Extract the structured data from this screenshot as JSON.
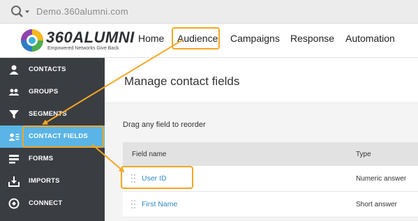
{
  "browser": {
    "url": "Demo.360alumni.com",
    "search_icon": "search-icon"
  },
  "header": {
    "logo_text": "360ALUMNI",
    "logo_tagline": "Empowered Networks Give Back",
    "nav": [
      "Home",
      "Audience",
      "Campaigns",
      "Response",
      "Automation"
    ]
  },
  "sidebar": {
    "items": [
      {
        "label": "CONTACTS",
        "icon": "person-icon"
      },
      {
        "label": "GROUPS",
        "icon": "group-icon"
      },
      {
        "label": "SEGMENTS",
        "icon": "filter-icon"
      },
      {
        "label": "CONTACT FIELDS",
        "icon": "contact-fields-icon",
        "active": true
      },
      {
        "label": "FORMS",
        "icon": "form-icon"
      },
      {
        "label": "IMPORTS",
        "icon": "import-icon"
      },
      {
        "label": "CONNECT",
        "icon": "connect-icon"
      }
    ]
  },
  "main": {
    "title": "Manage contact fields",
    "hint": "Drag any field to reorder",
    "columns": [
      "Field name",
      "Type"
    ],
    "rows": [
      {
        "name": "User ID",
        "type": "Numeric answer"
      },
      {
        "name": "First Name",
        "type": "Short answer"
      }
    ]
  },
  "colors": {
    "highlight": "#f5a623",
    "active": "#5ab4e5",
    "sidebar": "#3a3d42",
    "link": "#2f87c6"
  }
}
